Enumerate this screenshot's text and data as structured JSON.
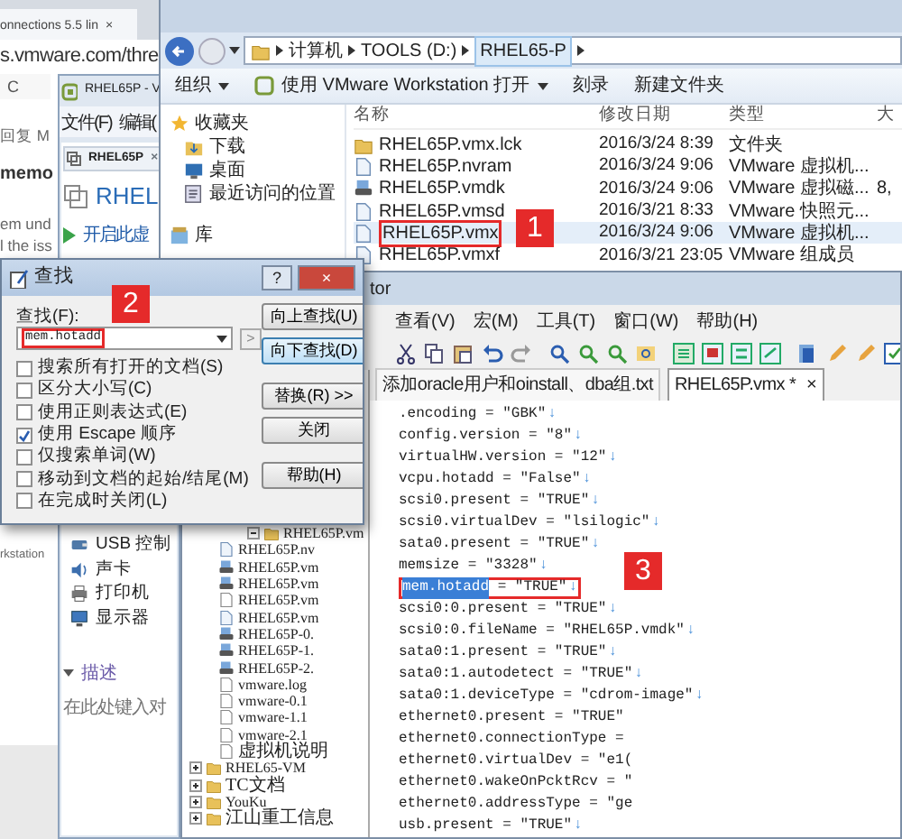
{
  "browser": {
    "tab_title": "onnections 5.5 lin",
    "tab_close": "×",
    "url": "s.vmware.com/thre",
    "bookmark": "C",
    "texts": [
      "回复 M",
      "memo",
      "em und",
      "l the iss",
      "rkstation"
    ]
  },
  "vmware_window": {
    "title": "RHEL65P - V",
    "menu": [
      "文件(F)",
      "编辑("
    ],
    "tab": {
      "label": "RHEL65P",
      "close": "×"
    },
    "vm_name": "RHEL",
    "actions": [
      "开启此虚"
    ],
    "devices": [
      {
        "label": "USB 控制",
        "kind": "usb"
      },
      {
        "label": "声卡",
        "kind": "sound"
      },
      {
        "label": "打印机",
        "kind": "printer"
      },
      {
        "label": "显示器",
        "kind": "display"
      }
    ],
    "description": {
      "label": "描述",
      "placeholder": "在此处键入对"
    }
  },
  "explorer": {
    "breadcrumb": [
      "计算机",
      "TOOLS (D:)",
      "RHEL65-P"
    ],
    "toolbar": [
      {
        "label": "组织",
        "dropdown": true,
        "kind": "plain"
      },
      {
        "label": "使用 VMware Workstation 打开",
        "dropdown": true,
        "kind": "vm"
      },
      {
        "label": "刻录",
        "dropdown": false,
        "kind": "plain"
      },
      {
        "label": "新建文件夹",
        "dropdown": false,
        "kind": "plain"
      }
    ],
    "nav": [
      {
        "label": "收藏夹",
        "kind": "star"
      },
      {
        "label": "下载",
        "kind": "download"
      },
      {
        "label": "桌面",
        "kind": "desktop"
      },
      {
        "label": "最近访问的位置",
        "kind": "recent"
      },
      {
        "label": "库",
        "kind": "library"
      }
    ],
    "columns": [
      "名称",
      "修改日期",
      "类型",
      "大"
    ],
    "files": [
      {
        "name": "RHEL65P.vmx.lck",
        "modified": "2016/3/24 8:39",
        "type": "文件夹",
        "kind": "folder",
        "selected": false
      },
      {
        "name": "RHEL65P.nvram",
        "modified": "2016/3/24 9:06",
        "type": "VMware 虚拟机...",
        "kind": "file",
        "selected": false
      },
      {
        "name": "RHEL65P.vmdk",
        "modified": "2016/3/24 9:06",
        "type": "VMware 虚拟磁...",
        "size": "8,",
        "kind": "disk",
        "selected": false
      },
      {
        "name": "RHEL65P.vmsd",
        "modified": "2016/3/21 8:33",
        "type": "VMware 快照元...",
        "kind": "file",
        "selected": false
      },
      {
        "name": "RHEL65P.vmx",
        "modified": "2016/3/24 9:06",
        "type": "VMware 虚拟机...",
        "kind": "file",
        "selected": true,
        "annotated": true
      },
      {
        "name": "RHEL65P.vmxf",
        "modified": "2016/3/21 23:05",
        "type": "VMware 组成员",
        "kind": "file",
        "selected": false
      }
    ]
  },
  "editor": {
    "title": "tor",
    "menu": [
      "查看(V)",
      "宏(M)",
      "工具(T)",
      "窗口(W)",
      "帮助(H)"
    ],
    "tabs": [
      {
        "label": "添加oracle用户和oinstall、dba组.txt",
        "selected": false
      },
      {
        "label": "RHEL65P.vmx *",
        "selected": true,
        "close": "×"
      }
    ],
    "lines": [
      {
        "text": ".encoding = \"GBK\"",
        "eol": "↓"
      },
      {
        "text": "config.version = \"8\"",
        "eol": "↓"
      },
      {
        "text": "virtualHW.version = \"12\"",
        "eol": "↓"
      },
      {
        "text": "vcpu.hotadd = \"False\"",
        "eol": "↓"
      },
      {
        "text": "scsi0.present = \"TRUE\"",
        "eol": "↓"
      },
      {
        "text": "scsi0.virtualDev = \"lsilogic\"",
        "eol": "↓"
      },
      {
        "text": "sata0.present = \"TRUE\"",
        "eol": "↓"
      },
      {
        "text": "memsize = \"3328\"",
        "eol": "↓"
      },
      {
        "selected_text": "mem.hotadd",
        "text": " = \"TRUE\"",
        "eol": "↓",
        "annotated": true
      },
      {
        "text": "scsi0:0.present = \"TRUE\"",
        "eol": "↓"
      },
      {
        "text": "scsi0:0.fileName = \"RHEL65P.vmdk\"",
        "eol": "↓"
      },
      {
        "text": "sata0:1.present = \"TRUE\"",
        "eol": "↓"
      },
      {
        "text": "sata0:1.autodetect = \"TRUE\"",
        "eol": "↓"
      },
      {
        "text": "sata0:1.deviceType = \"cdrom-image\"",
        "eol": "↓"
      },
      {
        "text": "ethernet0.present = \"TRUE\""
      },
      {
        "text": "ethernet0.connectionType ="
      },
      {
        "text": "ethernet0.virtualDev = \"e1("
      },
      {
        "text": "ethernet0.wakeOnPcktRcv = \""
      },
      {
        "text": "ethernet0.addressType = \"ge"
      },
      {
        "text": "usb.present = \"TRUE\"",
        "eol": "↓"
      }
    ],
    "tree": [
      {
        "label": "RHEL65P.vm",
        "kind": "folder",
        "expanded": true,
        "children": [
          {
            "label": "RHEL65P.nv",
            "kind": "file"
          },
          {
            "label": "RHEL65P.vm",
            "kind": "disk"
          },
          {
            "label": "RHEL65P.vm",
            "kind": "disk"
          },
          {
            "label": "RHEL65P.vm",
            "kind": "blank"
          },
          {
            "label": "RHEL65P.vm",
            "kind": "file"
          },
          {
            "label": "RHEL65P-0.",
            "kind": "disk"
          },
          {
            "label": "RHEL65P-1.",
            "kind": "disk"
          },
          {
            "label": "RHEL65P-2.",
            "kind": "disk"
          },
          {
            "label": "vmware.log",
            "kind": "blank"
          },
          {
            "label": "vmware-0.1",
            "kind": "blank"
          },
          {
            "label": "vmware-1.1",
            "kind": "blank"
          },
          {
            "label": "vmware-2.1",
            "kind": "blank"
          },
          {
            "label": "虚拟机说明",
            "kind": "blank"
          }
        ]
      },
      {
        "label": "RHEL65-VM",
        "kind": "folder",
        "expanded": false
      },
      {
        "label": "TC文档",
        "kind": "folder",
        "expanded": false
      },
      {
        "label": "YouKu",
        "kind": "folder",
        "expanded": false
      },
      {
        "label": "江山重工信息",
        "kind": "folder",
        "expanded": false
      }
    ]
  },
  "find_dialog": {
    "title": "查找",
    "help": "?",
    "close": "×",
    "field_label": "查找(F):",
    "value": "mem.hotadd",
    "value_annotated": true,
    "next": ">",
    "options": [
      {
        "label": "搜索所有打开的文档(S)",
        "checked": false
      },
      {
        "label": "区分大小写(C)",
        "checked": false
      },
      {
        "label": "使用正则表达式(E)",
        "checked": false
      },
      {
        "label": "使用 Escape 顺序",
        "checked": true
      },
      {
        "label": "仅搜索单词(W)",
        "checked": false
      },
      {
        "label": "移动到文档的起始/结尾(M)",
        "checked": false
      },
      {
        "label": "在完成时关闭(L)",
        "checked": false
      }
    ],
    "buttons": [
      {
        "label": "向上查找(U)",
        "default": false
      },
      {
        "label": "向下查找(D)",
        "default": true
      },
      {
        "label": "替换(R) >>",
        "default": false
      },
      {
        "label": "关闭",
        "default": false
      },
      {
        "label": "帮助(H)",
        "default": false
      }
    ]
  },
  "callouts": [
    "1",
    "2",
    "3"
  ]
}
